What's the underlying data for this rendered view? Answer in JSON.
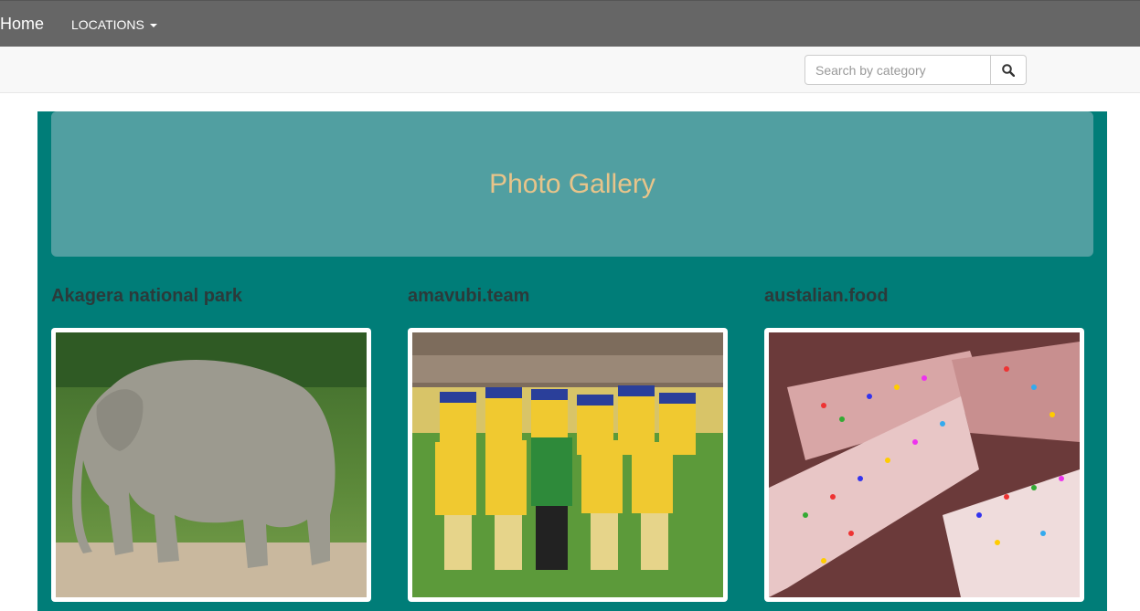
{
  "navbar": {
    "brand": "Home",
    "locations_label": "LOCATIONS"
  },
  "search": {
    "placeholder": "Search by category"
  },
  "jumbotron": {
    "title": "Photo Gallery"
  },
  "gallery": [
    {
      "title": "Akagera national park"
    },
    {
      "title": "amavubi.team"
    },
    {
      "title": "austalian.food"
    }
  ],
  "colors": {
    "navbar": "#666666",
    "container": "#007d78",
    "jumbotron": "#519fa1",
    "jumbotron_text": "#e8c48a"
  }
}
